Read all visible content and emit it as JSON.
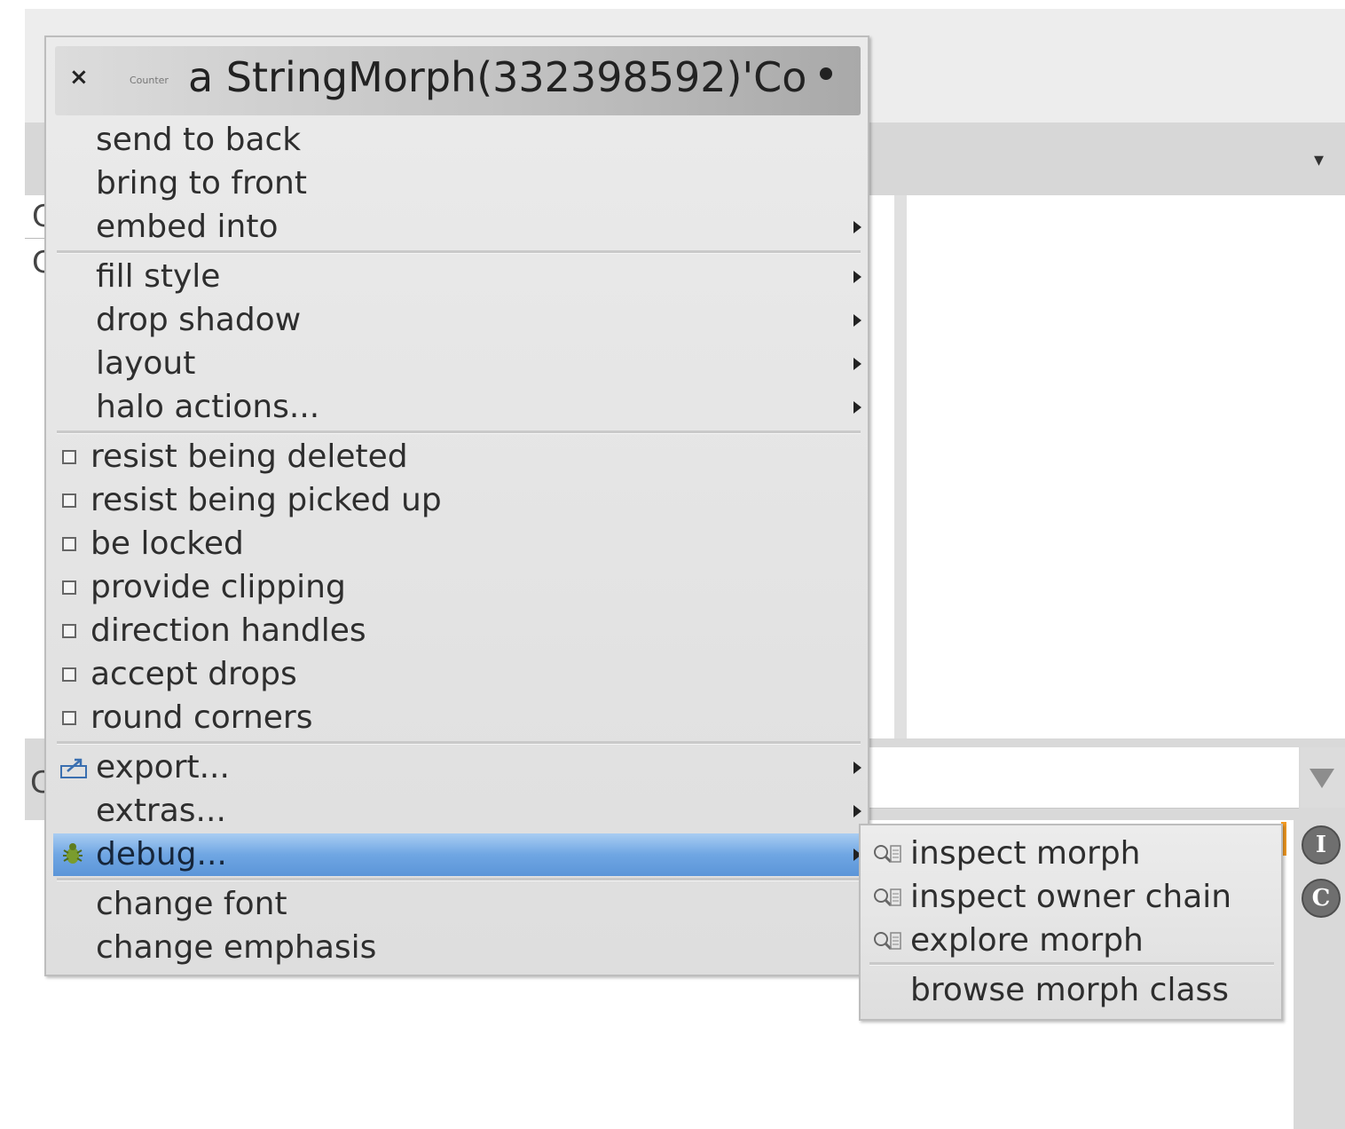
{
  "background": {
    "left_rows": [
      "C",
      "C"
    ],
    "bottom_label": "C",
    "side_icons": [
      "I",
      "C"
    ]
  },
  "menu": {
    "title": {
      "close": "×",
      "mini_label": "Counter",
      "text": "a StringMorph(332398592)'Co",
      "pin": "•"
    },
    "group1": [
      "send to back",
      "bring to front",
      "embed into"
    ],
    "group2": [
      "fill style",
      "drop shadow",
      "layout",
      "halo actions..."
    ],
    "toggles": [
      "resist being deleted",
      "resist being picked up",
      "be locked",
      "provide clipping",
      "direction handles",
      "accept drops",
      "round corners"
    ],
    "group3": [
      "export...",
      "extras...",
      "debug..."
    ],
    "group4": [
      "change font",
      "change emphasis"
    ]
  },
  "submenu": {
    "items": [
      "inspect morph",
      "inspect owner chain",
      "explore morph",
      "browse morph class"
    ]
  },
  "colors": {
    "selection": "#6fa6e3",
    "menu_bg": "#e4e4e4",
    "accent_orange": "#f39a22"
  },
  "icons": {
    "export": "export-icon",
    "debug": "bug-icon",
    "inspect": "inspector-icon"
  }
}
